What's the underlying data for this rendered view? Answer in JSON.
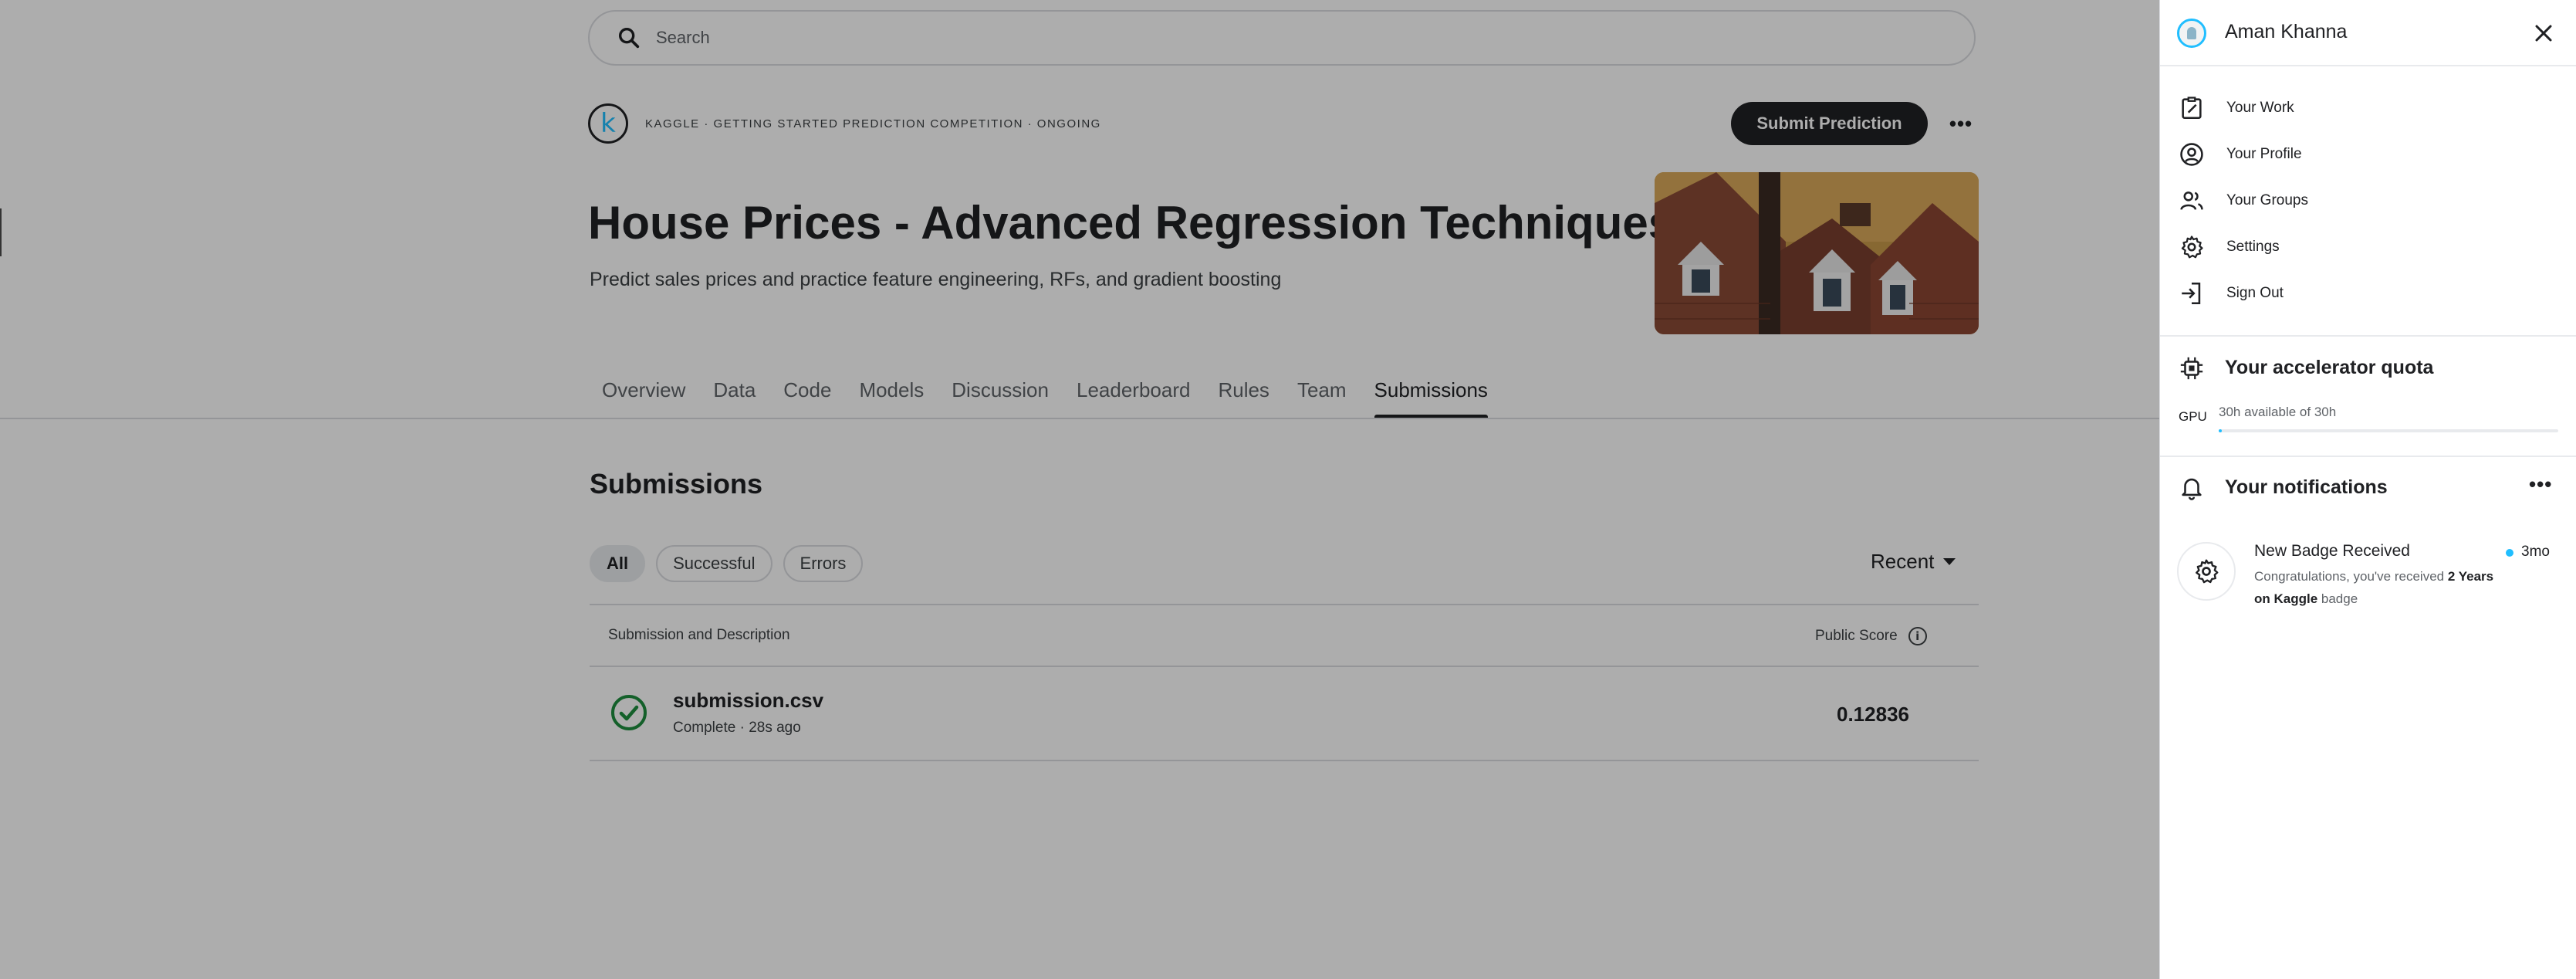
{
  "search": {
    "placeholder": "Search"
  },
  "competition": {
    "meta": "KAGGLE · GETTING STARTED PREDICTION COMPETITION · ONGOING",
    "title": "House Prices - Advanced Regression Techniques",
    "subtitle": "Predict sales prices and practice feature engineering, RFs, and gradient boosting",
    "submit_label": "Submit Prediction",
    "logo_letter": "k"
  },
  "tabs": [
    {
      "label": "Overview",
      "active": false
    },
    {
      "label": "Data",
      "active": false
    },
    {
      "label": "Code",
      "active": false
    },
    {
      "label": "Models",
      "active": false
    },
    {
      "label": "Discussion",
      "active": false
    },
    {
      "label": "Leaderboard",
      "active": false
    },
    {
      "label": "Rules",
      "active": false
    },
    {
      "label": "Team",
      "active": false
    },
    {
      "label": "Submissions",
      "active": true
    }
  ],
  "submissions": {
    "title": "Submissions",
    "filters": [
      {
        "label": "All",
        "active": true
      },
      {
        "label": "Successful",
        "active": false
      },
      {
        "label": "Errors",
        "active": false
      }
    ],
    "sort_label": "Recent",
    "columns": {
      "description": "Submission and Description",
      "score": "Public Score"
    },
    "rows": [
      {
        "file": "submission.csv",
        "status": "Complete · 28s ago",
        "score": "0.12836"
      }
    ]
  },
  "panel": {
    "user_name": "Aman Khanna",
    "menu": [
      {
        "label": "Your Work",
        "icon": "work-icon"
      },
      {
        "label": "Your Profile",
        "icon": "profile-icon"
      },
      {
        "label": "Your Groups",
        "icon": "groups-icon"
      },
      {
        "label": "Settings",
        "icon": "gear-icon"
      },
      {
        "label": "Sign Out",
        "icon": "sign-out-icon"
      }
    ],
    "quota": {
      "title": "Your accelerator quota",
      "gpu_label": "GPU",
      "gpu_text": "30h available of 30h",
      "gpu_fraction": 0.01
    },
    "notifications": {
      "title": "Your notifications",
      "items": [
        {
          "title": "New Badge Received",
          "body_prefix": "Congratulations, you've received ",
          "body_bold": "2 Years on Kaggle",
          "body_suffix": " badge",
          "time": "3mo"
        }
      ]
    }
  },
  "colors": {
    "accent": "#20beff",
    "success": "#1e8e3e",
    "dark": "#202124"
  }
}
